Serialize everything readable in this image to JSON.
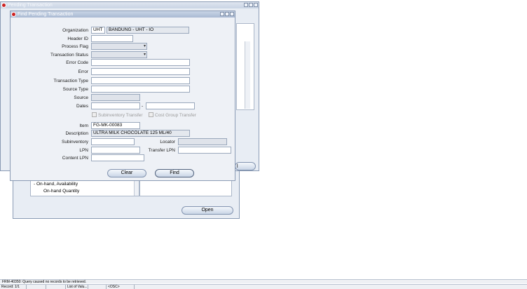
{
  "pending_window": {
    "title": "Pending Transaction",
    "tree_items": [
      "- On-hand, Availability",
      "On-hand Quantity"
    ],
    "open_button": "Open",
    "partial_button": "l"
  },
  "find_window": {
    "title": "Find Pending Transaction",
    "labels": {
      "organization": "Organization",
      "header_id": "Header ID",
      "process_flag": "Process Flag",
      "transaction_status": "Transaction Status",
      "error_code": "Error Code",
      "error": "Error",
      "transaction_type": "Transaction Type",
      "source_type": "Source Type",
      "source": "Source",
      "dates": "Dates",
      "dates_sep": "-",
      "subinventory_transfer": "Subinventory Transfer",
      "cost_group_transfer": "Cost Group Transfer",
      "item": "Item",
      "description": "Description",
      "subinventory": "Subinventory",
      "locator": "Locator",
      "lpn": "LPN",
      "transfer_lpn": "Transfer LPN",
      "content_lpn": "Content LPN"
    },
    "values": {
      "organization_code": "UHT",
      "organization_name": "BANDUNG - UHT - IO",
      "header_id": "",
      "process_flag": "",
      "transaction_status": "",
      "error_code": "",
      "error": "",
      "transaction_type": "",
      "source_type": "",
      "source": "",
      "date_from": "",
      "date_to": "",
      "item": "FG-MK-00083",
      "description": "ULTRA MILK CHOCOLATE 125 ML/40",
      "subinventory": "",
      "locator": "",
      "lpn": "",
      "transfer_lpn": "",
      "content_lpn": ""
    },
    "buttons": {
      "clear": "Clear",
      "find": "Find"
    }
  },
  "status_bar": {
    "message": "FRM-40350: Query caused no records to be retrieved.",
    "record": "Record: 1/1",
    "list_of_values": "List of Valu...",
    "osc": "<OSC>"
  }
}
